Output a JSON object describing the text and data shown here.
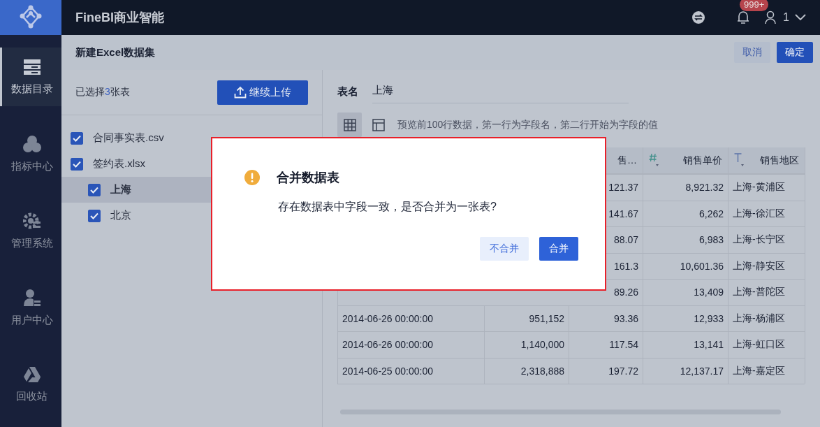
{
  "app": {
    "title": "FineBI商业智能"
  },
  "header": {
    "notification_badge": "999+",
    "user": "1"
  },
  "sidebar": {
    "items": [
      {
        "label": "数据目录",
        "selected": true
      },
      {
        "label": "指标中心",
        "selected": false
      },
      {
        "label": "管理系统",
        "selected": false
      },
      {
        "label": "用户中心",
        "selected": false
      },
      {
        "label": "回收站",
        "selected": false
      }
    ]
  },
  "page": {
    "title": "新建Excel数据集",
    "buttons": [
      {
        "label": "取消",
        "kind": "secondary"
      },
      {
        "label": "确定",
        "kind": "primary"
      }
    ]
  },
  "file_panel": {
    "selected_prefix": "已选择",
    "selected_count": "3",
    "selected_suffix": "张表",
    "upload_button": "继续上传",
    "files": [
      {
        "label": "合同事实表.csv",
        "checked": true,
        "selected": false
      },
      {
        "label": "签约表.xlsx",
        "checked": true,
        "selected": false,
        "children": [
          {
            "label": "上海",
            "checked": true,
            "selected": true
          },
          {
            "label": "北京",
            "checked": true,
            "selected": false
          }
        ]
      }
    ]
  },
  "preview": {
    "table_name_label": "表名",
    "table_name": "上海",
    "view_modes": [
      {
        "kind": "grid",
        "selected": true
      },
      {
        "kind": "layout",
        "selected": false
      }
    ],
    "hint": "预览前100行数据，第一行为字段名，第二行开始为字段的值",
    "table": {
      "columns": [
        null,
        null,
        {
          "label": "售…"
        },
        {
          "label": "销售单价",
          "kind": "number"
        },
        {
          "label": "销售地区",
          "kind": "text"
        }
      ],
      "rows": [
        {
          "column_3": "121.37",
          "column_4": "8,921.32",
          "column_5": "上海-黄浦区"
        },
        {
          "column_3": "141.67",
          "column_4": "6,262",
          "column_5": "上海-徐汇区"
        },
        {
          "column_3": "88.07",
          "column_4": "6,983",
          "column_5": "上海-长宁区"
        },
        {
          "column_3": "161.3",
          "column_4": "10,601.36",
          "column_5": "上海-静安区"
        },
        {
          "column_3": "89.26",
          "column_4": "13,409",
          "column_5": "上海-普陀区"
        },
        {
          "column_1": "2014-06-26 00:00:00",
          "column_2": "951,152",
          "column_3": "93.36",
          "column_4": "12,933",
          "column_5": "上海-杨浦区"
        },
        {
          "column_1": "2014-06-26 00:00:00",
          "column_2": "1,140,000",
          "column_3": "117.54",
          "column_4": "13,141",
          "column_5": "上海-虹口区"
        },
        {
          "column_1": "2014-06-25 00:00:00",
          "column_2": "2,318,888",
          "column_3": "197.72",
          "column_4": "12,137.17",
          "column_5": "上海-嘉定区"
        }
      ]
    }
  },
  "dialog": {
    "title": "合并数据表",
    "message": "存在数据表中字段一致，是否合并为一张表?",
    "buttons": [
      {
        "label": "不合并",
        "kind": "secondary"
      },
      {
        "label": "合并",
        "kind": "primary"
      }
    ]
  }
}
